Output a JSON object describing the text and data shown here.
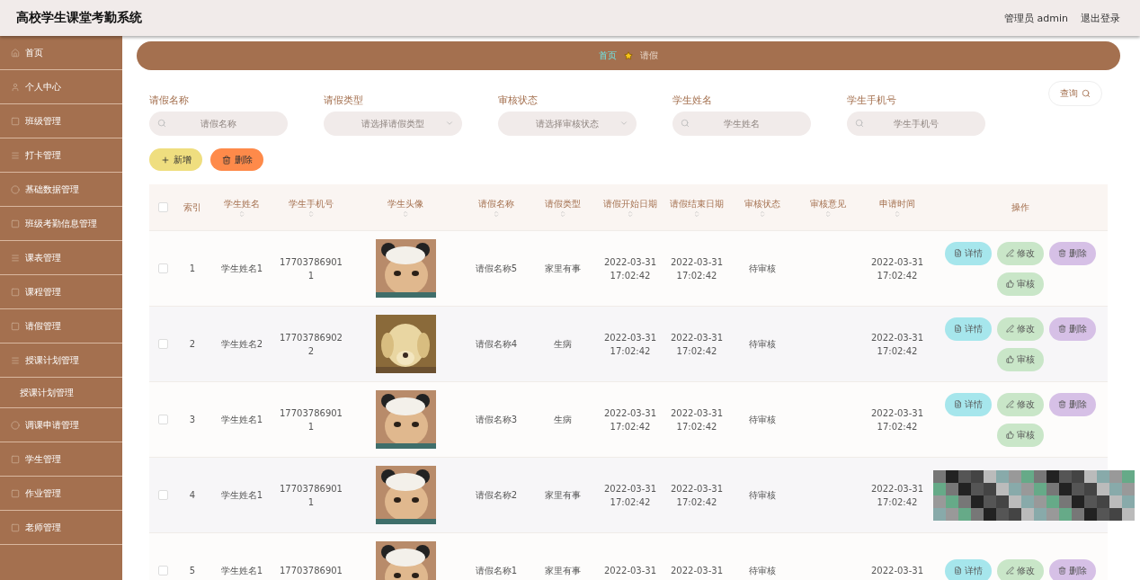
{
  "header": {
    "title": "高校学生课堂考勤系统",
    "user": "管理员 admin",
    "logout": "退出登录"
  },
  "sidebar": {
    "items": [
      {
        "label": "首页"
      },
      {
        "label": "个人中心"
      },
      {
        "label": "班级管理"
      },
      {
        "label": "打卡管理"
      },
      {
        "label": "基础数据管理"
      },
      {
        "label": "班级考勤信息管理"
      },
      {
        "label": "课表管理"
      },
      {
        "label": "课程管理"
      },
      {
        "label": "请假管理"
      },
      {
        "label": "授课计划管理",
        "children": [
          {
            "label": "授课计划管理"
          }
        ]
      },
      {
        "label": "调课申请管理"
      },
      {
        "label": "学生管理"
      },
      {
        "label": "作业管理"
      },
      {
        "label": "老师管理"
      }
    ]
  },
  "breadcrumb": [
    {
      "label": "首页",
      "selected": true
    },
    {
      "label": "请假",
      "selected": false
    }
  ],
  "filters": [
    {
      "kind": "input",
      "label": "请假名称",
      "placeholder": "请假名称"
    },
    {
      "kind": "select",
      "label": "请假类型",
      "placeholder": "请选择请假类型"
    },
    {
      "kind": "select",
      "label": "审核状态",
      "placeholder": "请选择审核状态"
    },
    {
      "kind": "input",
      "label": "学生姓名",
      "placeholder": "学生姓名"
    },
    {
      "kind": "input",
      "label": "学生手机号",
      "placeholder": "学生手机号"
    }
  ],
  "query_button": "查询",
  "toolbar": [
    {
      "kind": "add",
      "label": "新增"
    },
    {
      "kind": "delete",
      "label": "删除"
    }
  ],
  "table": {
    "all_checked": false,
    "columns": [
      {
        "label": "索引",
        "sortable": false
      },
      {
        "label": "学生姓名",
        "sortable": true
      },
      {
        "label": "学生手机号",
        "sortable": true
      },
      {
        "label": "学生头像",
        "sortable": true
      },
      {
        "label": "请假名称",
        "sortable": true
      },
      {
        "label": "请假类型",
        "sortable": true
      },
      {
        "label": "请假开始日期",
        "sortable": true
      },
      {
        "label": "请假结束日期",
        "sortable": true
      },
      {
        "label": "审核状态",
        "sortable": true
      },
      {
        "label": "审核意见",
        "sortable": true
      },
      {
        "label": "申请时间",
        "sortable": true
      },
      {
        "label": "操作",
        "sortable": false
      }
    ],
    "rows": [
      {
        "checked": false,
        "index": "1",
        "name": "学生姓名1",
        "phone": [
          "17703786901",
          "1"
        ],
        "avatar": {
          "kind": "picture"
        },
        "leave_name": "请假名称5",
        "leave_type": "家里有事",
        "start": [
          "2022-03-31",
          "17:02:42"
        ],
        "end": [
          "2022-03-31",
          "17:02:42"
        ],
        "status": "待审核",
        "applied": [
          "2022-03-31",
          "17:02:42"
        ],
        "actions_redacted": false,
        "actions": [
          {
            "kind": "detail",
            "label": "详情"
          },
          {
            "kind": "edit",
            "label": "修改"
          },
          {
            "kind": "delete",
            "label": "删除"
          },
          {
            "kind": "review",
            "label": "审核"
          }
        ]
      },
      {
        "checked": false,
        "index": "2",
        "name": "学生姓名2",
        "phone": [
          "17703786902",
          "2"
        ],
        "avatar": {
          "kind": "picture"
        },
        "leave_name": "请假名称4",
        "leave_type": "生病",
        "start": [
          "2022-03-31",
          "17:02:42"
        ],
        "end": [
          "2022-03-31",
          "17:02:42"
        ],
        "status": "待审核",
        "applied": [
          "2022-03-31",
          "17:02:42"
        ],
        "actions_redacted": false,
        "actions": [
          {
            "kind": "detail",
            "label": "详情"
          },
          {
            "kind": "edit",
            "label": "修改"
          },
          {
            "kind": "delete",
            "label": "删除"
          },
          {
            "kind": "review",
            "label": "审核"
          }
        ]
      },
      {
        "checked": false,
        "index": "3",
        "name": "学生姓名1",
        "phone": [
          "17703786901",
          "1"
        ],
        "avatar": {
          "kind": "picture"
        },
        "leave_name": "请假名称3",
        "leave_type": "生病",
        "start": [
          "2022-03-31",
          "17:02:42"
        ],
        "end": [
          "2022-03-31",
          "17:02:42"
        ],
        "status": "待审核",
        "applied": [
          "2022-03-31",
          "17:02:42"
        ],
        "actions_redacted": false,
        "actions": [
          {
            "kind": "detail",
            "label": "详情"
          },
          {
            "kind": "edit",
            "label": "修改"
          },
          {
            "kind": "delete",
            "label": "删除"
          },
          {
            "kind": "review",
            "label": "审核"
          }
        ]
      },
      {
        "checked": false,
        "index": "4",
        "name": "学生姓名1",
        "phone": [
          "17703786901",
          "1"
        ],
        "avatar": {
          "kind": "picture"
        },
        "leave_name": "请假名称2",
        "leave_type": "家里有事",
        "start": [
          "2022-03-31",
          "17:02:42"
        ],
        "end": [
          "2022-03-31",
          "17:02:42"
        ],
        "status": "待审核",
        "applied": [
          "2022-03-31",
          "17:02:42"
        ],
        "actions_redacted": true
      },
      {
        "checked": false,
        "index": "5",
        "name": "学生姓名1",
        "phone": [
          "17703786901"
        ],
        "avatar": {
          "kind": "picture"
        },
        "leave_name": "请假名称1",
        "leave_type": "家里有事",
        "start": [
          "2022-03-31"
        ],
        "end": [
          "2022-03-31"
        ],
        "status": "待审核",
        "applied": [
          "2022-03-31"
        ],
        "actions_redacted": false,
        "actions": [
          {
            "kind": "detail",
            "label": "详情"
          },
          {
            "kind": "edit",
            "label": "修改"
          },
          {
            "kind": "delete",
            "label": "删除"
          }
        ]
      }
    ]
  }
}
